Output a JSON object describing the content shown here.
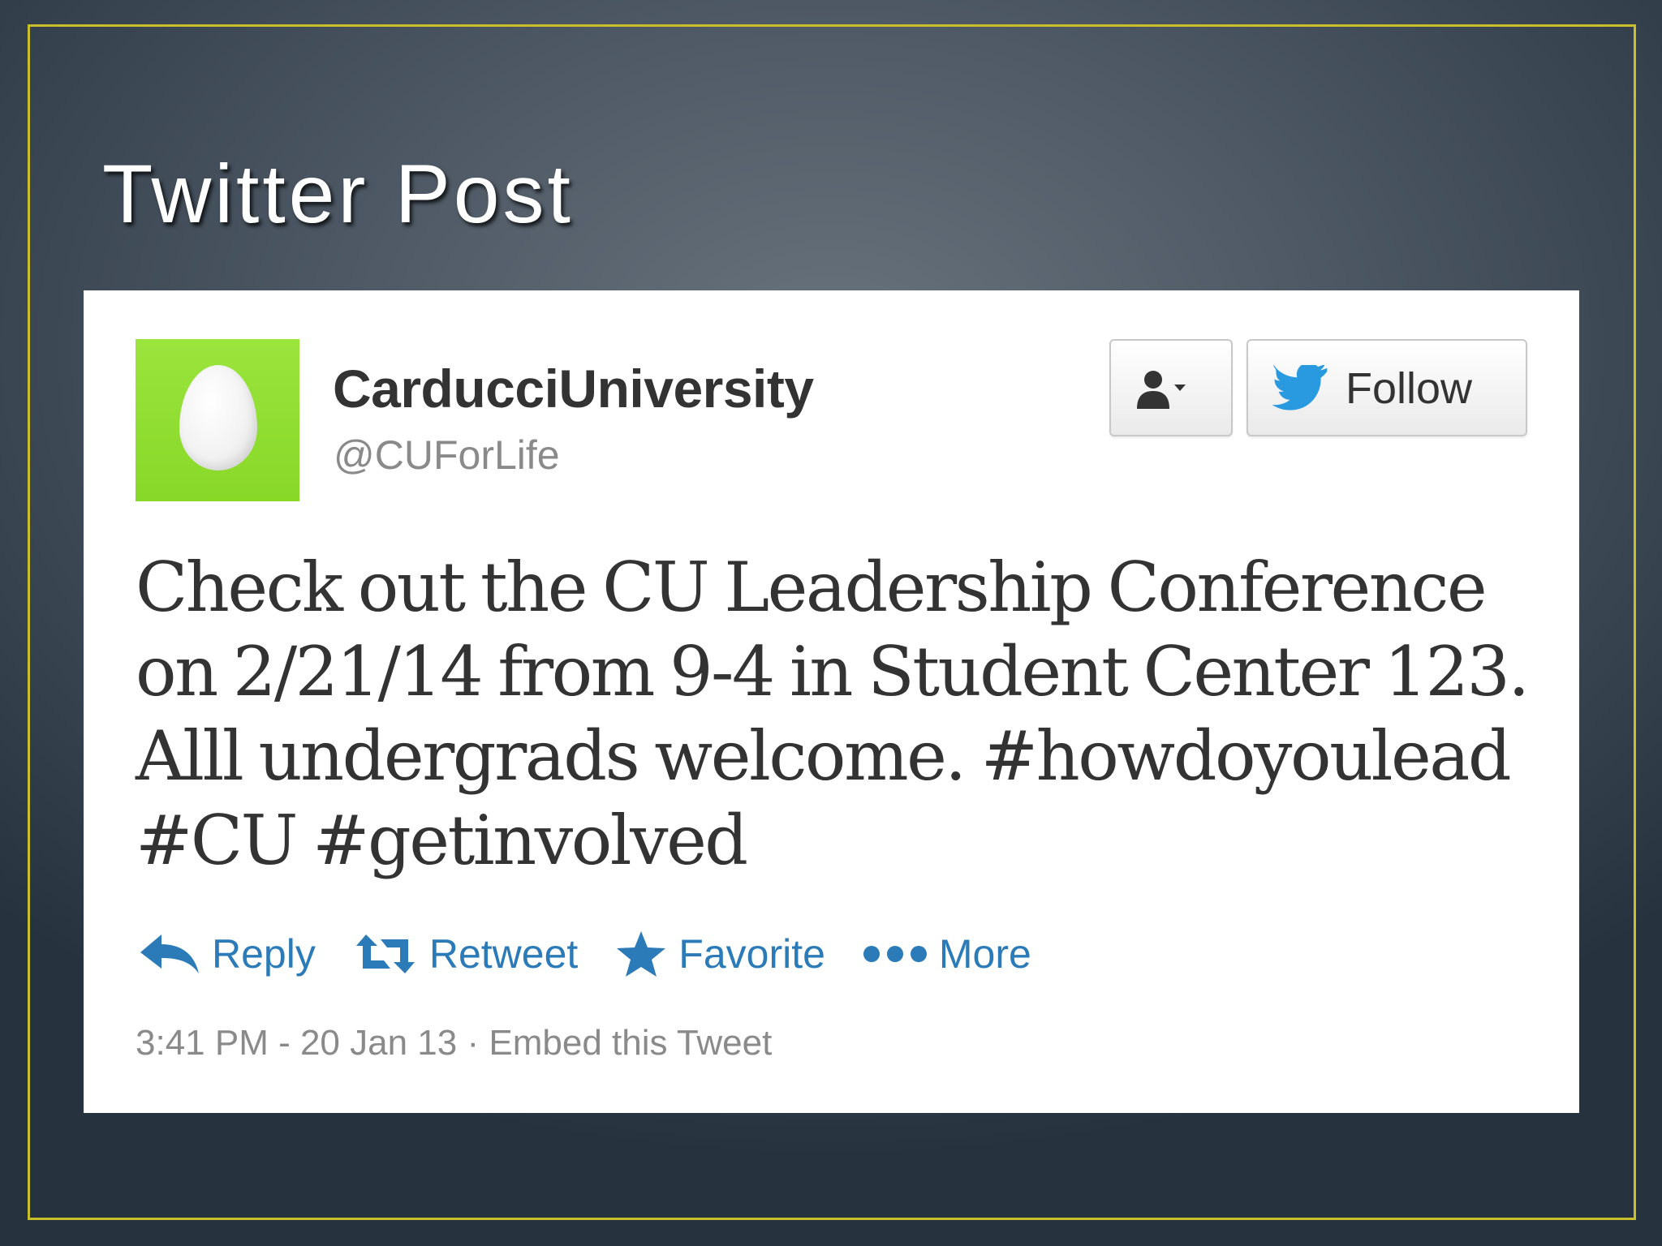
{
  "slide": {
    "title": "Twitter Post"
  },
  "tweet": {
    "display_name": "CarducciUniversity",
    "handle": "@CUForLife",
    "follow_label": "Follow",
    "text": "Check out the CU Leadership Conference on 2/21/14 from 9-4 in Student Center 123. Alll undergrads welcome. #howdoyoulead #CU #getinvolved",
    "actions": {
      "reply": "Reply",
      "retweet": "Retweet",
      "favorite": "Favorite",
      "more": "More"
    },
    "timestamp": "3:41 PM - 20 Jan 13",
    "separator": "·",
    "embed_label": "Embed this Tweet"
  },
  "icons": {
    "avatar": "egg-avatar-icon",
    "user_menu": "user-dropdown-icon",
    "follow": "twitter-bird-icon",
    "reply": "reply-arrow-icon",
    "retweet": "retweet-icon",
    "favorite": "star-icon",
    "more": "ellipsis-icon"
  },
  "colors": {
    "frame_border": "#c9bf2a",
    "avatar_background": "#8edc2e",
    "twitter_blue": "#2b7bb9",
    "link_blue": "#2b7bb9"
  }
}
